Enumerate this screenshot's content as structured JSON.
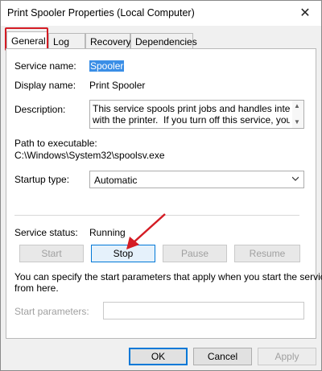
{
  "window": {
    "title": "Print Spooler Properties (Local Computer)",
    "close_glyph": "✕"
  },
  "tabs": [
    {
      "label": "General",
      "active": true
    },
    {
      "label": "Log On"
    },
    {
      "label": "Recovery"
    },
    {
      "label": "Dependencies"
    }
  ],
  "fields": {
    "service_name_label": "Service name:",
    "service_name_value": "Spooler",
    "display_name_label": "Display name:",
    "display_name_value": "Print Spooler",
    "description_label": "Description:",
    "description_value": "This service spools print jobs and handles interaction\nwith the printer.  If you turn off this service, you won't",
    "path_label": "Path to executable:",
    "path_value": "C:\\Windows\\System32\\spoolsv.exe",
    "startup_type_label": "Startup type:",
    "startup_type_value": "Automatic"
  },
  "status": {
    "label": "Service status:",
    "value": "Running"
  },
  "service_buttons": {
    "start": "Start",
    "stop": "Stop",
    "pause": "Pause",
    "resume": "Resume"
  },
  "params": {
    "help_text_line1": "You can specify the start parameters that apply when you start the service",
    "help_text_line2": "from here.",
    "label": "Start parameters:",
    "value": ""
  },
  "dialog_buttons": {
    "ok": "OK",
    "cancel": "Cancel",
    "apply": "Apply"
  },
  "annotation_colors": {
    "highlight": "#d41c24"
  }
}
